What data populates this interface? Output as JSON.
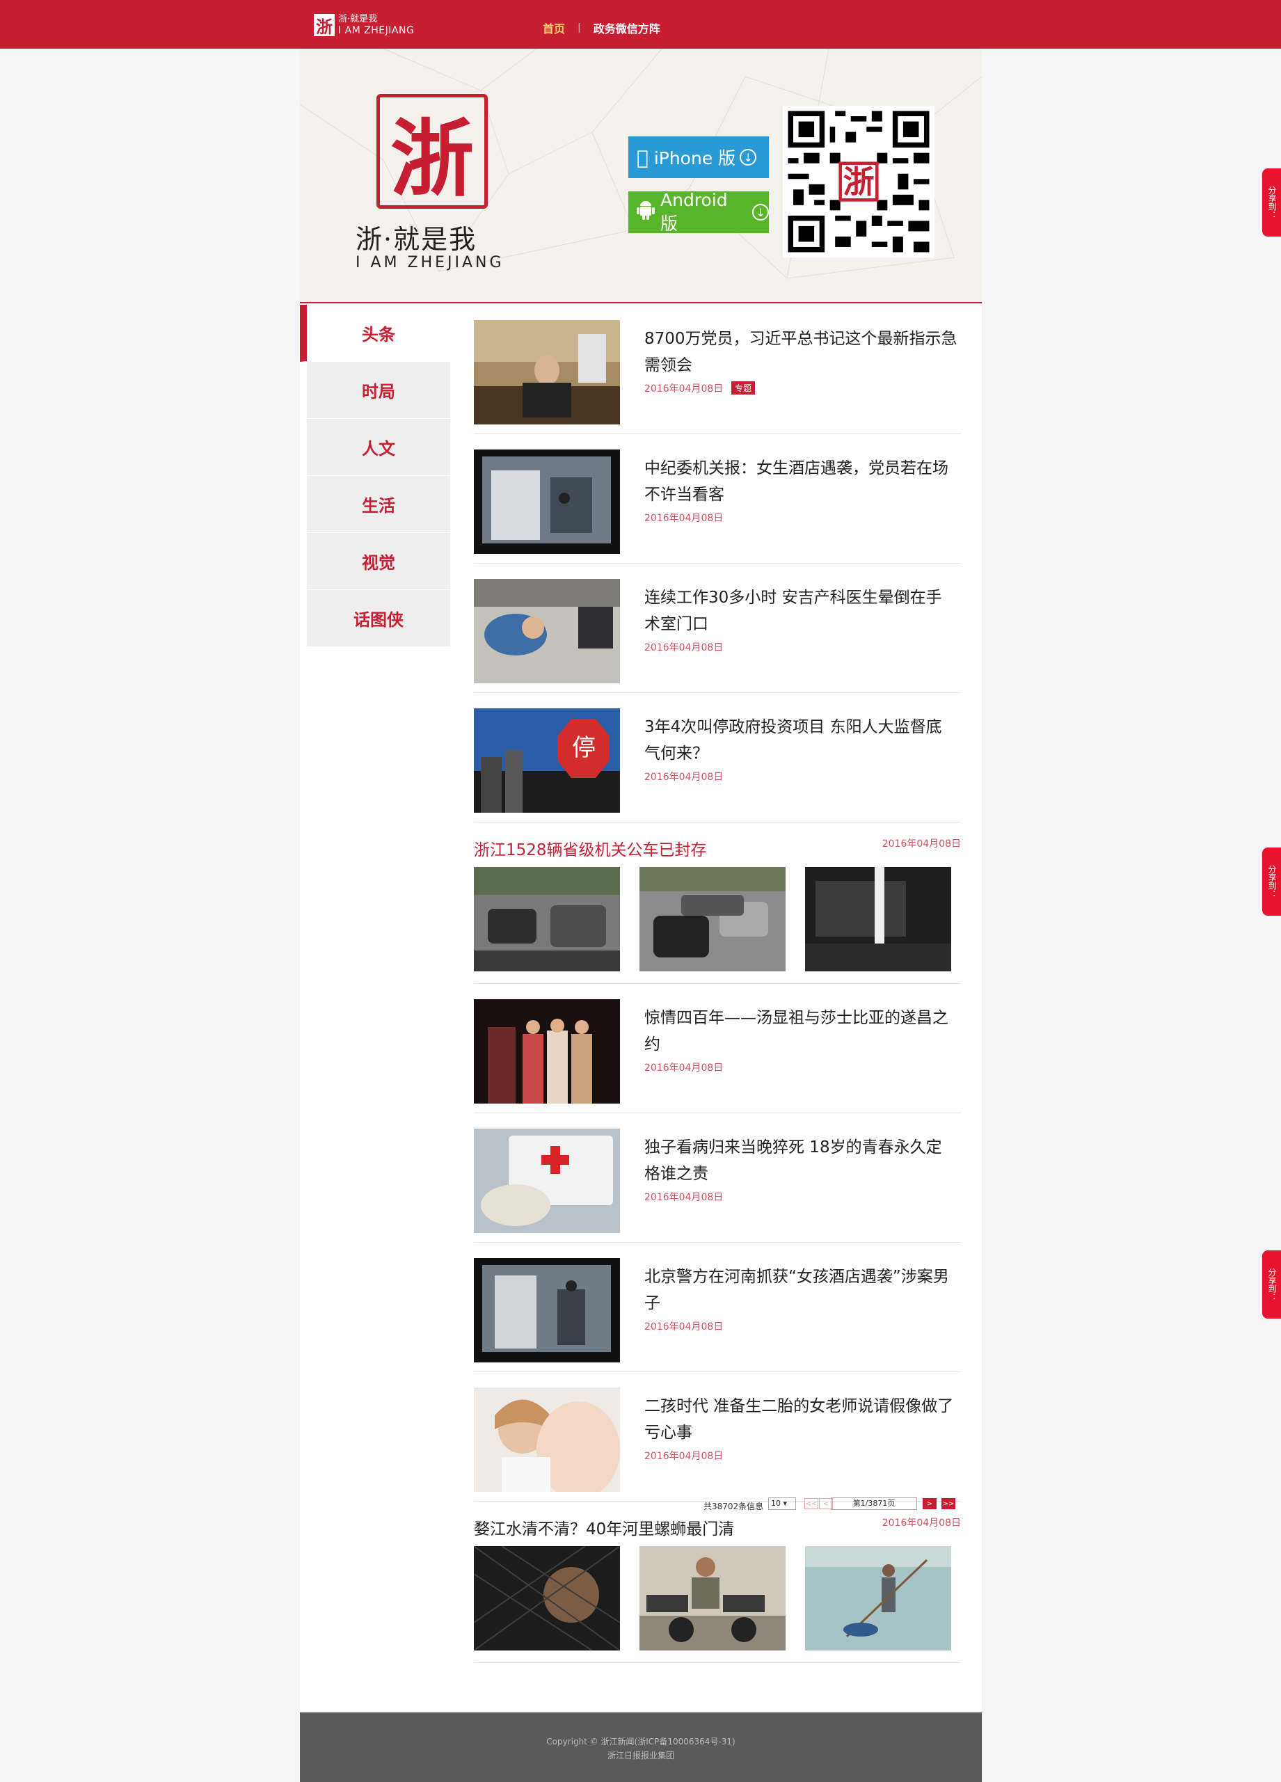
{
  "topbar": {
    "logo_zh": "浙·就是我",
    "logo_en": "I AM ZHEJIANG",
    "nav": [
      {
        "label": "首页"
      },
      {
        "label": "政务微信方阵"
      }
    ],
    "nav_sep": "|"
  },
  "header": {
    "seal_char": "浙",
    "slogan": "浙·就是我",
    "slogan_en": "I AM ZHEJIANG",
    "iphone_label": "iPhone 版",
    "android_label": "Android 版"
  },
  "sidebar": {
    "items": [
      {
        "label": "头条"
      },
      {
        "label": "时局"
      },
      {
        "label": "人文"
      },
      {
        "label": "生活"
      },
      {
        "label": "视觉"
      },
      {
        "label": "话图侠"
      }
    ]
  },
  "news": [
    {
      "title": "8700万党员，习近平总书记这个最新指示急需领会",
      "date": "2016年04月08日",
      "tag": "专题"
    },
    {
      "title": "中纪委机关报：女生酒店遇袭，党员若在场不许当看客",
      "date": "2016年04月08日"
    },
    {
      "title": "连续工作30多小时 安吉产科医生晕倒在手术室门口",
      "date": "2016年04月08日"
    },
    {
      "title": "3年4次叫停政府投资项目 东阳人大监督底气何来？",
      "date": "2016年04月08日"
    }
  ],
  "gallery1": {
    "title": "浙江1528辆省级机关公车已封存",
    "date": "2016年04月08日"
  },
  "news2": [
    {
      "title": "惊情四百年——汤显祖与莎士比亚的遂昌之约",
      "date": "2016年04月08日"
    },
    {
      "title": "独子看病归来当晚猝死 18岁的青春永久定格谁之责",
      "date": "2016年04月08日"
    },
    {
      "title": "北京警方在河南抓获“女孩酒店遇袭”涉案男子",
      "date": "2016年04月08日"
    },
    {
      "title": "二孩时代 准备生二胎的女老师说请假像做了亏心事",
      "date": "2016年04月08日"
    }
  ],
  "gallery2": {
    "title": "婺江水清不清？40年河里螺蛳最门清",
    "date": "2016年04月08日"
  },
  "pager": {
    "info": "共38702条信息",
    "per_page": "10 ▾",
    "first": "<<",
    "prev": "<",
    "page_text": "第1/3871页",
    "next": ">",
    "last": ">>"
  },
  "footer": {
    "line1": "Copyright © 浙江新闻(浙ICP备10006364号-31)",
    "line2": "浙江日报报业集团"
  },
  "share_label": "分享到：",
  "colors": {
    "brand_red": "#c71e32",
    "iphone_blue": "#2a9ad5",
    "android_green": "#58b52a"
  }
}
